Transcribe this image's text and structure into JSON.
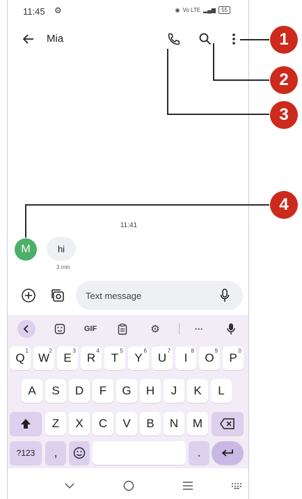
{
  "status_bar": {
    "time": "11:45",
    "signal_text": "Vo LTE",
    "battery": "55"
  },
  "app_bar": {
    "contact_name": "Mia"
  },
  "conversation": {
    "timestamp": "11:41",
    "avatar_letter": "M",
    "message_text": "hi",
    "message_time": "3 min"
  },
  "compose": {
    "placeholder": "Text message"
  },
  "keyboard": {
    "toolbar": {
      "gif": "GIF",
      "more": "···"
    },
    "rows": [
      [
        {
          "label": "Q",
          "hint": "1"
        },
        {
          "label": "W",
          "hint": "2"
        },
        {
          "label": "E",
          "hint": "3"
        },
        {
          "label": "R",
          "hint": "4"
        },
        {
          "label": "T",
          "hint": "5"
        },
        {
          "label": "Y",
          "hint": "6"
        },
        {
          "label": "U",
          "hint": "7"
        },
        {
          "label": "I",
          "hint": "8"
        },
        {
          "label": "O",
          "hint": "9"
        },
        {
          "label": "P",
          "hint": "0"
        }
      ],
      [
        {
          "label": "A"
        },
        {
          "label": "S"
        },
        {
          "label": "D"
        },
        {
          "label": "F"
        },
        {
          "label": "G"
        },
        {
          "label": "H"
        },
        {
          "label": "J"
        },
        {
          "label": "K"
        },
        {
          "label": "L"
        }
      ],
      [
        {
          "label": "Z"
        },
        {
          "label": "X"
        },
        {
          "label": "C"
        },
        {
          "label": "V"
        },
        {
          "label": "B"
        },
        {
          "label": "N"
        },
        {
          "label": "M"
        }
      ]
    ],
    "symbols_key": "?123",
    "comma_key": ",",
    "period_key": "."
  },
  "callouts": [
    "1",
    "2",
    "3",
    "4"
  ],
  "colors": {
    "accent": "#cc2a1c",
    "avatar": "#4caf6a",
    "keyboard_bg": "#f2ecf7",
    "function_key": "#ddd0ef"
  }
}
